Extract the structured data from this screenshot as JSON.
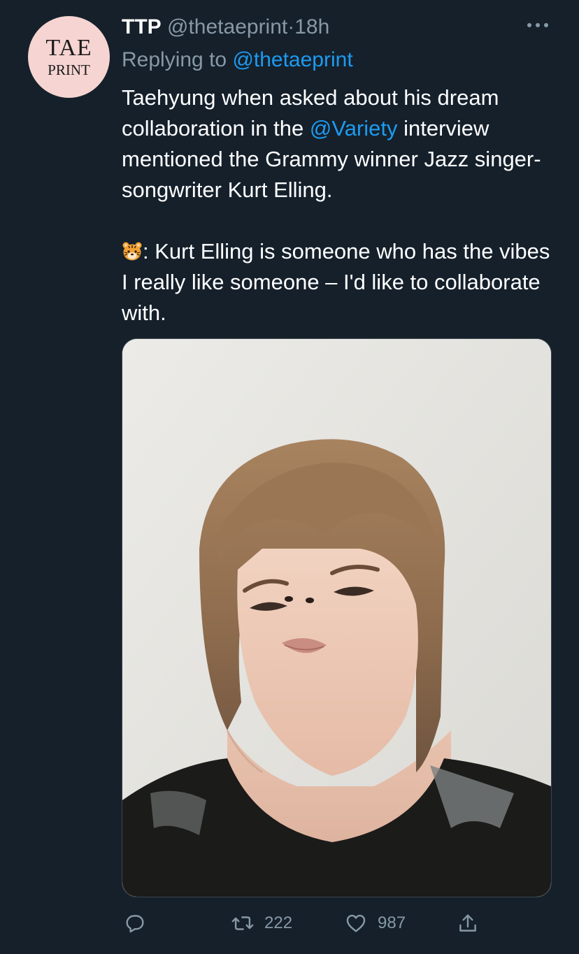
{
  "tweet": {
    "avatar": {
      "line1": "TAE",
      "line2": "PRINT",
      "bg": "#f6d4d1"
    },
    "display_name": "TTP",
    "handle": "@thetaeprint",
    "separator": "·",
    "time": "18h",
    "replying_prefix": "Replying to ",
    "replying_handle": "@thetaeprint",
    "text1_a": "Taehyung when asked about his dream collaboration in the ",
    "text1_mention": "@Variety",
    "text1_b": " interview mentioned the Grammy winner Jazz singer-songwriter Kurt Elling.",
    "text2": ": Kurt Elling is someone who has the vibes I really like someone – I'd like to collaborate with.",
    "emoji_icon": "tiger-face-icon",
    "media_alt": "photo of a person with shoulder-length light brown hair looking up at the camera"
  },
  "actions": {
    "reply_icon": "reply-icon",
    "retweet_icon": "retweet-icon",
    "retweet_count": "222",
    "like_icon": "heart-icon",
    "like_count": "987",
    "share_icon": "share-icon"
  },
  "colors": {
    "background": "#15202b",
    "secondary_text": "#8899a6",
    "link": "#1d9bf0",
    "border": "#38444d"
  }
}
